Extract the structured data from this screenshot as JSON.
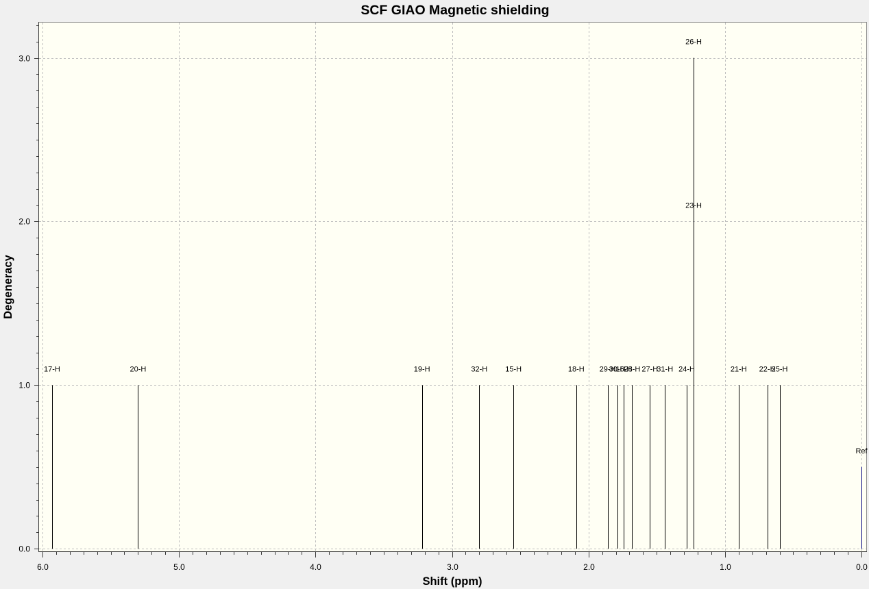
{
  "colors": {
    "window_background": "#F0F0F0",
    "plot_background": "#FFFFF4",
    "grid": "#BEBEBE",
    "stick": "#000000",
    "reference_stick": "#000080"
  },
  "chart_data": {
    "type": "bar",
    "title": "SCF GIAO Magnetic shielding",
    "xlabel": "Shift (ppm)",
    "ylabel": "Degeneracy",
    "xlim": [
      6.03,
      -0.04
    ],
    "ylim": [
      -0.02,
      3.22
    ],
    "x_ticks": [
      "6.0",
      "5.0",
      "4.0",
      "3.0",
      "2.0",
      "1.0",
      "0.0"
    ],
    "y_ticks": [
      "0.0",
      "1.0",
      "2.0",
      "3.0"
    ],
    "grid": true,
    "peaks": [
      {
        "label": "17-H",
        "shift_ppm": 5.93,
        "degeneracy": 1
      },
      {
        "label": "20-H",
        "shift_ppm": 5.3,
        "degeneracy": 1
      },
      {
        "label": "19-H",
        "shift_ppm": 3.22,
        "degeneracy": 1
      },
      {
        "label": "32-H",
        "shift_ppm": 2.8,
        "degeneracy": 1
      },
      {
        "label": "15-H",
        "shift_ppm": 2.55,
        "degeneracy": 1
      },
      {
        "label": "18-H",
        "shift_ppm": 2.09,
        "degeneracy": 1
      },
      {
        "label": "29-H",
        "shift_ppm": 1.86,
        "degeneracy": 1
      },
      {
        "label": "30-H",
        "shift_ppm": 1.79,
        "degeneracy": 1
      },
      {
        "label": "16-H",
        "shift_ppm": 1.74,
        "degeneracy": 1
      },
      {
        "label": "28-H",
        "shift_ppm": 1.68,
        "degeneracy": 1
      },
      {
        "label": "27-H",
        "shift_ppm": 1.55,
        "degeneracy": 1
      },
      {
        "label": "31-H",
        "shift_ppm": 1.44,
        "degeneracy": 1
      },
      {
        "label": "24-H",
        "shift_ppm": 1.28,
        "degeneracy": 1
      },
      {
        "label": "23-H",
        "shift_ppm": 1.23,
        "degeneracy": 2
      },
      {
        "label": "26-H",
        "shift_ppm": 1.23,
        "degeneracy": 3
      },
      {
        "label": "21-H",
        "shift_ppm": 0.9,
        "degeneracy": 1
      },
      {
        "label": "22-H",
        "shift_ppm": 0.69,
        "degeneracy": 1
      },
      {
        "label": "25-H",
        "shift_ppm": 0.6,
        "degeneracy": 1
      },
      {
        "label": "Ref",
        "shift_ppm": 0.0,
        "degeneracy": 0.5,
        "reference": true
      }
    ]
  }
}
